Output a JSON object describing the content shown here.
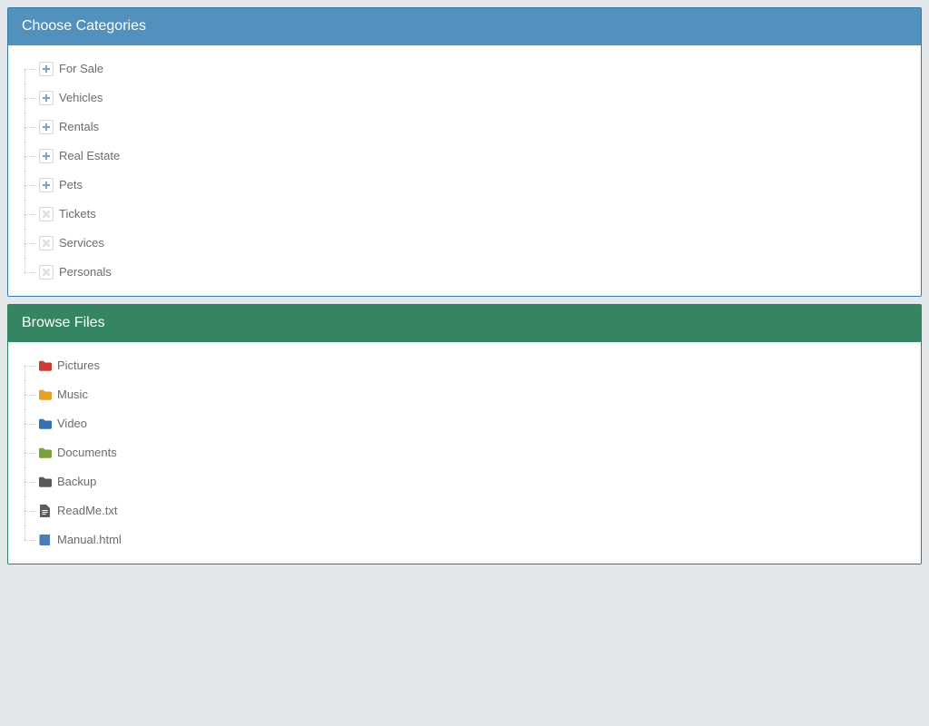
{
  "panels": {
    "categories": {
      "title": "Choose Categories",
      "items": [
        {
          "label": "For Sale",
          "expander": "plus"
        },
        {
          "label": "Vehicles",
          "expander": "plus"
        },
        {
          "label": "Rentals",
          "expander": "plus"
        },
        {
          "label": "Real Estate",
          "expander": "plus"
        },
        {
          "label": "Pets",
          "expander": "plus"
        },
        {
          "label": "Tickets",
          "expander": "x"
        },
        {
          "label": "Services",
          "expander": "x"
        },
        {
          "label": "Personals",
          "expander": "x"
        }
      ]
    },
    "files": {
      "title": "Browse Files",
      "items": [
        {
          "label": "Pictures",
          "icon": "folder",
          "color": "red"
        },
        {
          "label": "Music",
          "icon": "folder",
          "color": "orange"
        },
        {
          "label": "Video",
          "icon": "folder",
          "color": "blue"
        },
        {
          "label": "Documents",
          "icon": "folder",
          "color": "green"
        },
        {
          "label": "Backup",
          "icon": "folder",
          "color": "dark"
        },
        {
          "label": "ReadMe.txt",
          "icon": "file",
          "color": "grey"
        },
        {
          "label": "Manual.html",
          "icon": "book",
          "color": "book"
        }
      ]
    }
  },
  "colors": {
    "primary_header": "#5290bd",
    "success_header": "#358560",
    "red": "#cc3d33",
    "orange": "#e89f27",
    "blue": "#3572b0",
    "green": "#7aa23c",
    "dark": "#565a5c",
    "grey": "#5a5e60",
    "book": "#4a7eb5"
  }
}
